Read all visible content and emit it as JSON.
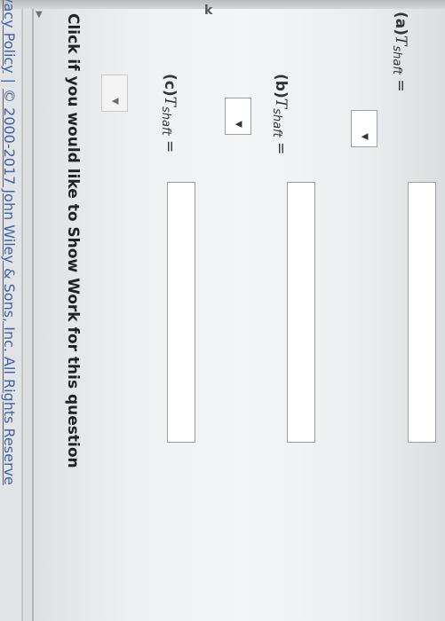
{
  "parts": [
    {
      "letter": "(a)",
      "variable": "T",
      "subscript": "shaft",
      "equals": "=",
      "answer": ""
    },
    {
      "letter": "(b)",
      "variable": "T",
      "subscript": "shaft",
      "equals": "=",
      "answer": ""
    },
    {
      "letter": "(c)",
      "variable": "T",
      "subscript": "shaft",
      "equals": "=",
      "answer": ""
    }
  ],
  "units_dropdowns": [
    {
      "selected": ""
    },
    {
      "selected": ""
    },
    {
      "selected": ""
    }
  ],
  "show_work": "Click if you would like to Show Work for this question",
  "footer": {
    "privacy": "vacy Policy",
    "separator": "|",
    "copyright": "© 2000-2017 John Wiley & Sons, Inc. All Rights Reserve"
  },
  "corner_glyph": "k",
  "collapse_arrow": "▼",
  "dropdown_arrow": "▼",
  "colors": {
    "link": "#3d63a8",
    "text": "#333333",
    "input_border": "#9aa0a6"
  }
}
